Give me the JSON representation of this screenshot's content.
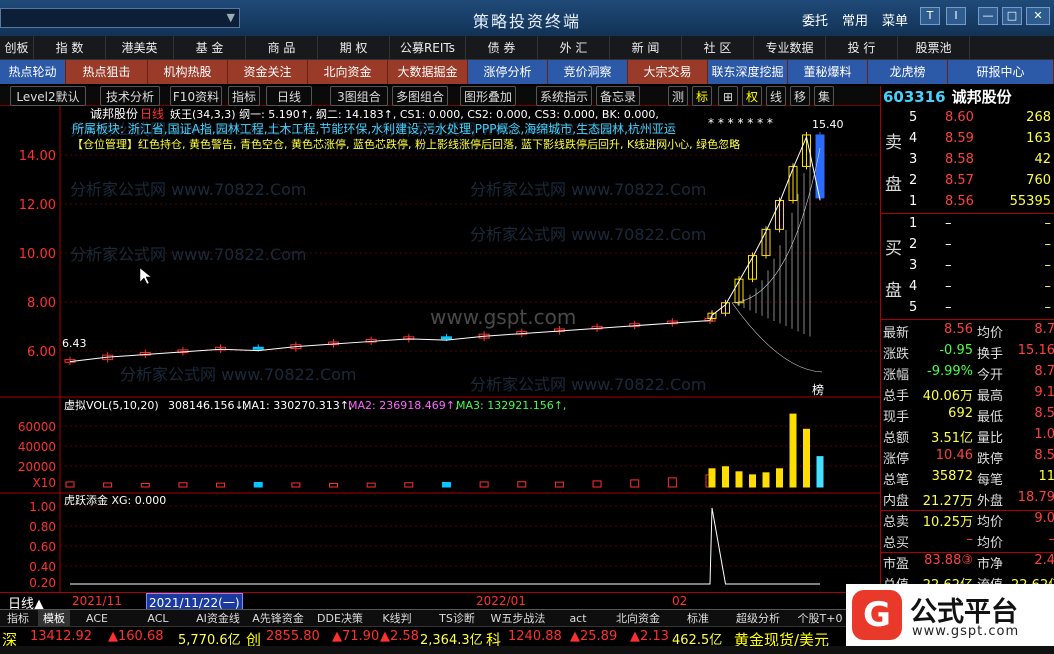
{
  "titlebar": {
    "title": "策略投资终端",
    "buttons": [
      "委托",
      "常用",
      "菜单"
    ],
    "window_icons": [
      "T",
      "I",
      "—",
      "□",
      "✕"
    ]
  },
  "menubar": [
    "创板",
    "指 数",
    "港美英",
    "基 金",
    "商 品",
    "期 权",
    "公募REITs",
    "债 券",
    "外 汇",
    "新 闻",
    "社 区",
    "专业数据",
    "投 行",
    "股票池"
  ],
  "subbar": [
    "热点轮动",
    "热点狙击",
    "机构热股",
    "资金关注",
    "北向资金",
    "大数据掘金",
    "涨停分析",
    "竞价洞察",
    "大宗交易",
    "联东深度挖掘",
    "董秘爆料",
    "龙虎榜",
    "研报中心"
  ],
  "toolbar": {
    "items": [
      "Level2默认",
      "技术分析",
      "F10资料",
      "指标",
      "日线",
      "3图组合",
      "多图组合",
      "图形叠加",
      "系统指示",
      "备忘录"
    ],
    "right_items": [
      "测",
      "标",
      "⊞",
      "权",
      "线",
      "移",
      "集"
    ]
  },
  "chart_main": {
    "header_stock": "诚邦股份",
    "header_period": "日线",
    "header_rest": "妖王(34,3,3) 纲一: 5.190↑, 纲二: 14.183↑, CS1: 0.000, CS2: 0.000, CS3: 0.000, BK: 0.000,",
    "sector_line": "所属板块: 浙江省,国证A指,园林工程,土木工程,节能环保,水利建设,污水处理,PPP概念,海绵城市,生态园林,杭州亚运",
    "legend_line": "【仓位管理】红色持仓, 黄色警告, 青色空仓, 黄色芯涨停, 蓝色芯跌停, 粉上影线涨停后回落, 蓝下影线跌停后回升, K线进网小心, 绿色忽略",
    "y_ticks": [
      "14.00",
      "12.00",
      "10.00",
      "8.00",
      "6.00"
    ],
    "low_label": "6.43",
    "high_label": "15.40",
    "marker_label": "榜",
    "watermarks": [
      "分析家公式网 www.70822.Com",
      "分析家公式网 www.70822.Com",
      "分析家公式网 www.70822.Com",
      "分析家公式网 www.70822.Com",
      "分析家公式网 www.70822.Com",
      "分析家公式网 www.70822.Com",
      "分析家公式网 www.70822.Com",
      "分析家公式网 www.70822.Com"
    ],
    "center_watermark": "www.gspt.com"
  },
  "chart_vol": {
    "header_name": "虚拟VOL(5,10,20)",
    "header_value": "308146.156↓,",
    "ma1": "MA1: 330270.313↑,",
    "ma2": "MA2: 236918.469↑,",
    "ma3": "MA3: 132921.156↑,",
    "y_ticks": [
      "60000",
      "40000",
      "20000"
    ],
    "unit": "X10"
  },
  "chart_ind": {
    "header": "虎跃添金 XG: 0.000",
    "y_ticks": [
      "1.00",
      "0.80",
      "0.60",
      "0.40",
      "0.20",
      "0.00"
    ]
  },
  "chart_data": {
    "type": "candlestick",
    "title": "诚邦股份 日线",
    "ylim": [
      5.5,
      15.8
    ],
    "series": [
      {
        "name": "price_close",
        "values": [
          6.43,
          6.6,
          6.7,
          6.8,
          6.9,
          6.85,
          7.0,
          7.1,
          7.2,
          7.3,
          7.25,
          7.4,
          7.5,
          7.6,
          7.7,
          7.8,
          7.9,
          8.0,
          8.2,
          8.6,
          9.5,
          10.4,
          11.4,
          12.5,
          13.8,
          15.0,
          12.6
        ]
      },
      {
        "name": "volume",
        "values": [
          5000,
          4000,
          3500,
          4200,
          3800,
          4500,
          4000,
          3500,
          3800,
          4200,
          4500,
          5000,
          5200,
          4800,
          6000,
          7000,
          9000,
          12000,
          18000,
          20000,
          15000,
          12000,
          14000,
          18000,
          72000,
          57000,
          30000
        ]
      },
      {
        "name": "XG",
        "values": [
          0,
          0,
          0,
          0,
          0,
          0,
          0,
          0,
          0,
          0,
          0,
          0,
          0,
          0,
          0,
          0,
          0,
          0,
          1,
          0,
          0,
          0,
          0,
          0,
          0,
          0,
          0
        ]
      }
    ]
  },
  "datebar": {
    "period": "日线▲",
    "dates": [
      "2021/11",
      "2021/11/22(一)",
      "2022/01",
      "02"
    ]
  },
  "rightpanel": {
    "code": "603316",
    "name": "诚邦股份",
    "sell_label": [
      "卖",
      "盘"
    ],
    "buy_label": [
      "买",
      "盘"
    ],
    "sells": [
      {
        "lvl": "5",
        "price": "8.60",
        "vol": "268"
      },
      {
        "lvl": "4",
        "price": "8.59",
        "vol": "163"
      },
      {
        "lvl": "3",
        "price": "8.58",
        "vol": "42"
      },
      {
        "lvl": "2",
        "price": "8.57",
        "vol": "760"
      },
      {
        "lvl": "1",
        "price": "8.56",
        "vol": "55395"
      }
    ],
    "buys": [
      {
        "lvl": "1",
        "price": "–",
        "vol": "–"
      },
      {
        "lvl": "2",
        "price": "–",
        "vol": "–"
      },
      {
        "lvl": "3",
        "price": "–",
        "vol": "–"
      },
      {
        "lvl": "4",
        "price": "–",
        "vol": "–"
      },
      {
        "lvl": "5",
        "price": "–",
        "vol": "–"
      }
    ],
    "stats": [
      {
        "l": "最新",
        "v": "8.56",
        "l2": "均价",
        "v2": "8.7"
      },
      {
        "l": "涨跌",
        "v": "-0.95",
        "l2": "换手",
        "v2": "15.16"
      },
      {
        "l": "涨幅",
        "v": "-9.99%",
        "l2": "今开",
        "v2": "8.7"
      },
      {
        "l": "总手",
        "v": "40.06万",
        "l2": "最高",
        "v2": "9.1"
      },
      {
        "l": "现手",
        "v": "692",
        "l2": "最低",
        "v2": "8.5"
      },
      {
        "l": "总额",
        "v": "3.51亿",
        "l2": "量比",
        "v2": "1.0"
      },
      {
        "l": "涨停",
        "v": "10.46",
        "l2": "跌停",
        "v2": "8.5"
      },
      {
        "l": "总笔",
        "v": "35872",
        "l2": "每笔",
        "v2": "11"
      },
      {
        "l": "内盘",
        "v": "21.27万",
        "l2": "外盘",
        "v2": "18.79"
      },
      {
        "l": "总卖",
        "v": "10.25万",
        "l2": "均价",
        "v2": "9.0"
      },
      {
        "l": "总买",
        "v": "–",
        "l2": "均价",
        "v2": "–"
      },
      {
        "l": "市盈",
        "v": "83.88③",
        "l2": "市净",
        "v2": "2.4"
      },
      {
        "l": "总值",
        "v": "22.62亿",
        "l2": "流值",
        "v2": "22.62亿"
      }
    ]
  },
  "bottomtabs": [
    "指标",
    "模板",
    "ACE",
    "ACL",
    "AI资金线",
    "A先锋资金",
    "DDE决策",
    "K线判",
    "TS诊断",
    "W五步战法",
    "act",
    "北向资金",
    "标准",
    "超级分析",
    "个股T+0"
  ],
  "ticker": [
    {
      "name": "深",
      "val": "13412.92",
      "chg": "▲160.68",
      "amt": "5,770.6亿"
    },
    {
      "name": "创",
      "val": "2855.80",
      "chg": "▲71.90",
      "pct": "▲2.58",
      "amt": "2,364.3亿"
    },
    {
      "name": "科",
      "val": "1240.88",
      "chg": "▲25.89",
      "pct": "▲2.13",
      "amt": "462.5亿"
    },
    {
      "name": "黄金现货/美元"
    }
  ],
  "logo": {
    "mark": "G",
    "title": "公式平台",
    "url": "www.gspt.com"
  },
  "colors": {
    "up": "#ff3030",
    "down": "#00e0ff",
    "yellow": "#ffff44",
    "accent": "#44d3ff"
  }
}
